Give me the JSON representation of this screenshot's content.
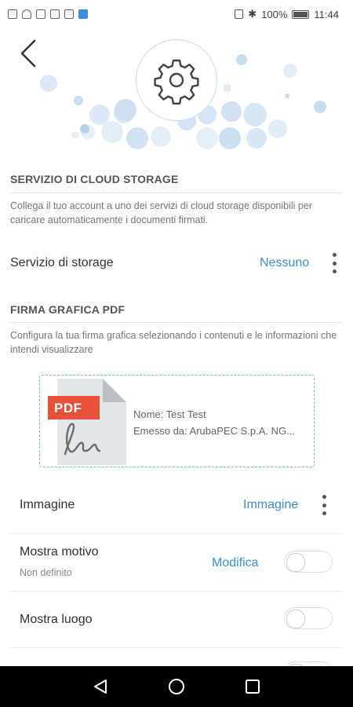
{
  "status_bar": {
    "battery": "100%",
    "time": "11:44"
  },
  "cloud_section": {
    "title": "SERVIZIO DI CLOUD STORAGE",
    "description": "Collega il tuo account a uno dei servizi di cloud storage disponibili per caricare automaticamente i documenti firmati.",
    "storage_label": "Servizio di storage",
    "storage_value": "Nessuno"
  },
  "signature_section": {
    "title": "FIRMA GRAFICA PDF",
    "description": "Configura la tua firma grafica selezionando i contenuti e le informazioni che intendi visualizzare",
    "preview": {
      "badge": "PDF",
      "name_line": "Nome: Test Test",
      "issuer_line": "Emesso da: ArubaPEC S.p.A. NG..."
    },
    "image_label": "Immagine",
    "image_value": "Immagine",
    "motivo_label": "Mostra motivo",
    "motivo_sub": "Non definito",
    "motivo_action": "Modifica",
    "luogo_label": "Mostra luogo"
  },
  "colors": {
    "accent": "#3a8fd6",
    "badge_red": "#e8503a"
  }
}
